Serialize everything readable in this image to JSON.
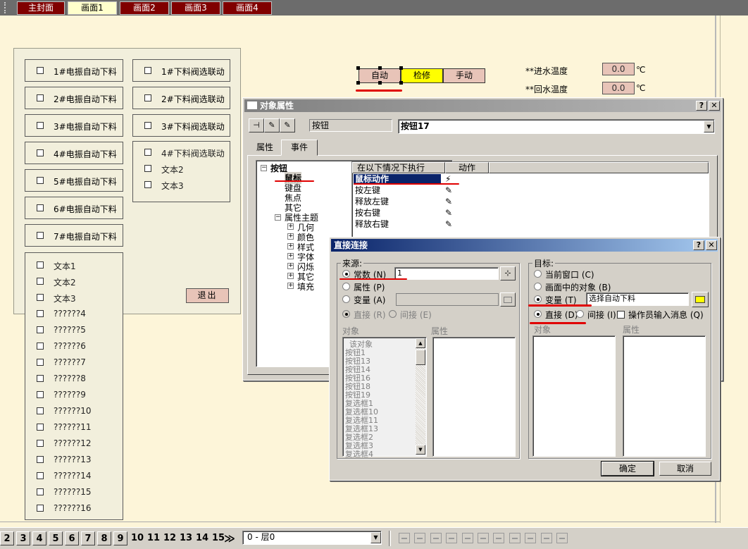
{
  "top_tabs": [
    "主封面",
    "画面1",
    "画面2",
    "画面3",
    "画面4"
  ],
  "active_tab": "画面1",
  "left_checkboxes": [
    "1#电振自动下料",
    "2#电振自动下料",
    "3#电振自动下料",
    "4#电振自动下料",
    "5#电振自动下料",
    "6#电振自动下料",
    "7#电振自动下料"
  ],
  "mid_checkboxes": [
    "1#下料阀选联动",
    "2#下料阀选联动",
    "3#下料阀选联动",
    "4#下料阀选联动"
  ],
  "mid_texts": [
    "文本2",
    "文本3"
  ],
  "lower_list": [
    "文本1",
    "文本2",
    "文本3",
    "??????4",
    "??????5",
    "??????6",
    "??????7",
    "??????8",
    "??????9",
    "??????10",
    "??????11",
    "??????12",
    "??????13",
    "??????14",
    "??????15",
    "??????16"
  ],
  "state_buttons": {
    "auto": "自动",
    "repair": "检修",
    "manual": "手动"
  },
  "temps": {
    "in_label": "**进水温度",
    "in_value": "0.0",
    "out_label": "**回水温度",
    "out_value": "0.0",
    "unit": "℃"
  },
  "exit_button": "退出",
  "obj_dialog": {
    "title": "对象属性",
    "type_label": "按钮",
    "name_value": "按钮17",
    "tabs": [
      "属性",
      "事件"
    ],
    "tree": {
      "root": "按钮",
      "children": [
        "鼠标",
        "键盘",
        "焦点",
        "其它"
      ],
      "prop_root": "属性主题",
      "props": [
        "几何",
        "颜色",
        "样式",
        "字体",
        "闪烁",
        "其它",
        "填充"
      ]
    },
    "col_headers": [
      "在以下情况下执行",
      "动作"
    ],
    "events": [
      "鼠标动作",
      "按左键",
      "释放左键",
      "按右键",
      "释放右键"
    ]
  },
  "direct_dialog": {
    "title": "直接连接",
    "source_group": "来源",
    "source_options": [
      "常数 (N)",
      "属性 (P)",
      "变量 (A)"
    ],
    "const_value": "1",
    "sub_options": [
      "直接 (R)",
      "间接 (E)"
    ],
    "obj_header": "对象",
    "prop_header": "属性",
    "objects": [
      "该对象",
      "按钮1",
      "按钮13",
      "按钮14",
      "按钮16",
      "按钮18",
      "按钮19",
      "复选框1",
      "复选框10",
      "复选框11",
      "复选框13",
      "复选框2",
      "复选框3",
      "复选框4"
    ],
    "target_group": "目标",
    "target_options": [
      "当前窗口 (C)",
      "画面中的对象 (B)",
      "变量 (T)"
    ],
    "var_value": "选择自动下料",
    "target_sub": [
      "直接 (D)",
      "间接 (I)"
    ],
    "operator_msg": "操作员输入消息 (Q)",
    "ok": "确定",
    "cancel": "取消"
  },
  "bottom": {
    "pages": [
      "2",
      "3",
      "4",
      "5",
      "6",
      "7",
      "8",
      "9",
      "10",
      "11",
      "12",
      "13",
      "14",
      "15"
    ],
    "more": "≫",
    "layer": "0 - 层0"
  }
}
